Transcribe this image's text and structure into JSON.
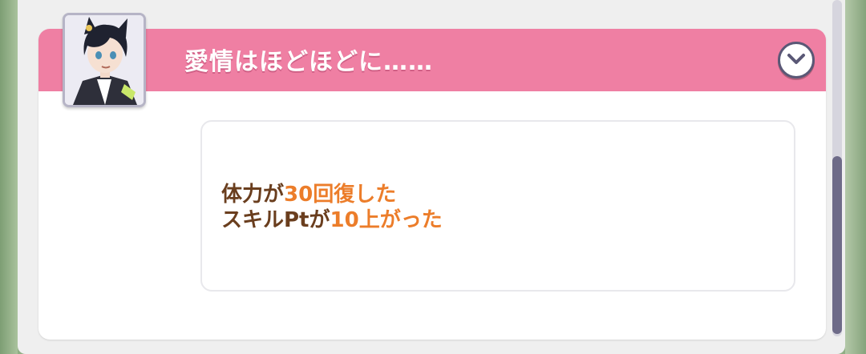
{
  "event": {
    "title": "愛情はほどほどに……",
    "toggle_icon": "chevron-down-icon",
    "avatar_icon": "character-portrait",
    "results": [
      {
        "pre": "体力が",
        "value": "30",
        "post": "回復した"
      },
      {
        "pre": "スキルPtが",
        "value": "10",
        "post": "上がった"
      }
    ]
  },
  "colors": {
    "header": "#ef7fa3",
    "text": "#6a3e1e",
    "highlight": "#ec7d2a",
    "scrollbar": "#6e6b88"
  }
}
